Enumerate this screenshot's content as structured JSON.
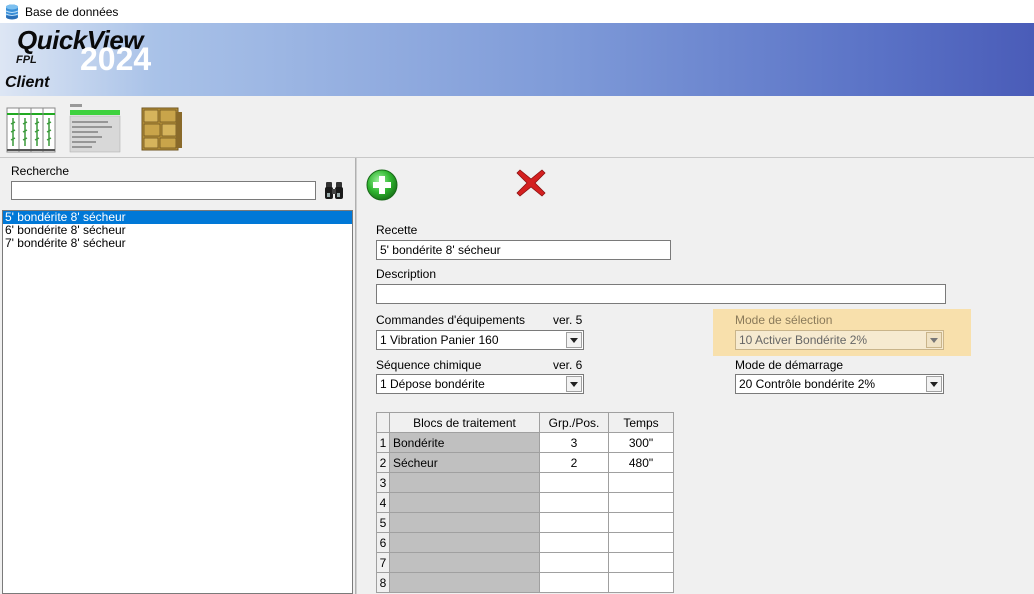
{
  "window": {
    "title": "Base de données"
  },
  "banner": {
    "brand": "QuickView",
    "year": "2024",
    "sub": "FPL",
    "client": "Client"
  },
  "toolbar": {
    "buttons": [
      {
        "icon": "tank-layout-icon"
      },
      {
        "icon": "program-sheet-icon"
      },
      {
        "icon": "boxes-icon"
      }
    ]
  },
  "search": {
    "label": "Recherche",
    "value": "",
    "placeholder": ""
  },
  "recipes_list": [
    {
      "label": "5' bondérite 8' sécheur",
      "selected": true
    },
    {
      "label": "6' bondérite 8' sécheur",
      "selected": false
    },
    {
      "label": "7' bondérite 8' sécheur",
      "selected": false
    }
  ],
  "form": {
    "recette_label": "Recette",
    "recette_value": "5' bondérite 8' sécheur",
    "description_label": "Description",
    "description_value": "",
    "commandes_label": "Commandes d'équipements",
    "commandes_version": "ver. 5",
    "commandes_value": "1 Vibration Panier 160",
    "sequence_label": "Séquence chimique",
    "sequence_version": "ver. 6",
    "sequence_value": "1 Dépose bondérite",
    "mode_selection_label": "Mode de sélection",
    "mode_selection_value": "10 Activer Bondérite 2%",
    "mode_demarrage_label": "Mode de démarrage",
    "mode_demarrage_value": "20 Contrôle bondérite 2%"
  },
  "grid": {
    "headers": [
      "Blocs de traitement",
      "Grp./Pos.",
      "Temps"
    ],
    "rows": [
      {
        "num": "1",
        "name": "Bondérite",
        "grp": "3",
        "time": "300\""
      },
      {
        "num": "2",
        "name": "Sécheur",
        "grp": "2",
        "time": "480\""
      },
      {
        "num": "3",
        "name": "",
        "grp": "",
        "time": ""
      },
      {
        "num": "4",
        "name": "",
        "grp": "",
        "time": ""
      },
      {
        "num": "5",
        "name": "",
        "grp": "",
        "time": ""
      },
      {
        "num": "6",
        "name": "",
        "grp": "",
        "time": ""
      },
      {
        "num": "7",
        "name": "",
        "grp": "",
        "time": ""
      },
      {
        "num": "8",
        "name": "",
        "grp": "",
        "time": ""
      }
    ]
  },
  "colors": {
    "selection": "#0078d7",
    "highlight": "#f9dda0",
    "banner_end": "#4a5cb8",
    "add_green": "#2fb52f",
    "delete_red": "#d42020"
  }
}
